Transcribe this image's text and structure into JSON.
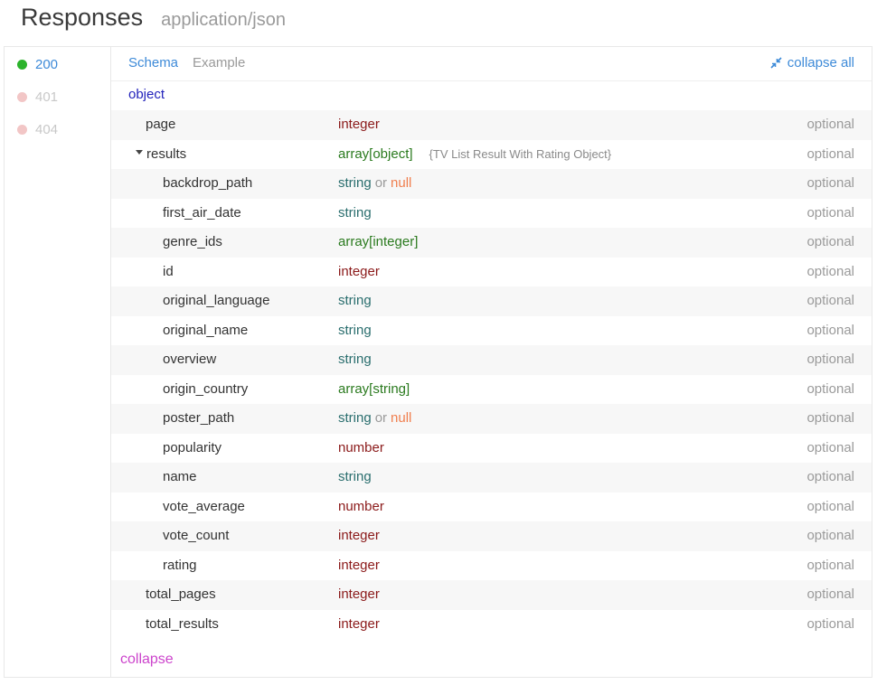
{
  "header": {
    "title": "Responses",
    "content_type": "application/json"
  },
  "status_codes": [
    {
      "code": "200",
      "active": true
    },
    {
      "code": "401",
      "active": false
    },
    {
      "code": "404",
      "active": false
    }
  ],
  "tabs": {
    "schema": "Schema",
    "example": "Example",
    "collapse_all": "collapse all"
  },
  "root_type": "object",
  "fields": [
    {
      "name": "page",
      "level": 1,
      "type": "integer",
      "optional": "optional"
    },
    {
      "name": "results",
      "level": 1,
      "type": "array[object]",
      "desc": "{TV List Result With Rating Object}",
      "expandable": true,
      "optional": "optional"
    },
    {
      "name": "backdrop_path",
      "level": 2,
      "type": "string",
      "or": "or",
      "nullable": "null",
      "optional": "optional"
    },
    {
      "name": "first_air_date",
      "level": 2,
      "type": "string",
      "optional": "optional"
    },
    {
      "name": "genre_ids",
      "level": 2,
      "type": "array[integer]",
      "optional": "optional"
    },
    {
      "name": "id",
      "level": 2,
      "type": "integer",
      "optional": "optional"
    },
    {
      "name": "original_language",
      "level": 2,
      "type": "string",
      "optional": "optional"
    },
    {
      "name": "original_name",
      "level": 2,
      "type": "string",
      "optional": "optional"
    },
    {
      "name": "overview",
      "level": 2,
      "type": "string",
      "optional": "optional"
    },
    {
      "name": "origin_country",
      "level": 2,
      "type": "array[string]",
      "optional": "optional"
    },
    {
      "name": "poster_path",
      "level": 2,
      "type": "string",
      "or": "or",
      "nullable": "null",
      "optional": "optional"
    },
    {
      "name": "popularity",
      "level": 2,
      "type": "number",
      "optional": "optional"
    },
    {
      "name": "name",
      "level": 2,
      "type": "string",
      "optional": "optional"
    },
    {
      "name": "vote_average",
      "level": 2,
      "type": "number",
      "optional": "optional"
    },
    {
      "name": "vote_count",
      "level": 2,
      "type": "integer",
      "optional": "optional"
    },
    {
      "name": "rating",
      "level": 2,
      "type": "integer",
      "optional": "optional"
    },
    {
      "name": "total_pages",
      "level": 1,
      "type": "integer",
      "optional": "optional"
    },
    {
      "name": "total_results",
      "level": 1,
      "type": "integer",
      "optional": "optional"
    }
  ],
  "collapse_label": "collapse",
  "colors": {
    "accent": "#3d8ad8",
    "success": "#2bb32b",
    "error_dot": "#f2c6c6",
    "collapse": "#cc44cc"
  }
}
